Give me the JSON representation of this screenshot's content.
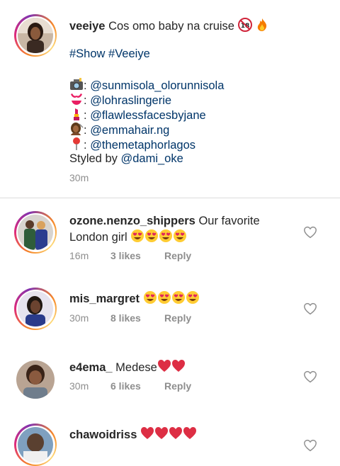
{
  "post": {
    "username": "veeiye",
    "caption_line1": "Cos omo baby na cruise",
    "hashtags": "#Show #Veeiye",
    "credits": [
      {
        "icon": "camera-icon",
        "handle": "@sunmisola_olorunnisola"
      },
      {
        "icon": "bikini-icon",
        "handle": "@lohraslingerie"
      },
      {
        "icon": "lipstick-icon",
        "handle": "@flawlessfacesbyjane"
      },
      {
        "icon": "hair-salon-icon",
        "handle": "@emmahair.ng"
      },
      {
        "icon": "pin-icon",
        "handle": "@themetaphorlagos"
      }
    ],
    "styled_prefix": "Styled by",
    "styled_handle": "@dami_oke",
    "time": "30m",
    "colon": ":"
  },
  "comments": [
    {
      "username": "ozone.nenzo_shippers",
      "text_line1": "Our favorite",
      "text_line2": "London girl",
      "emojis": [
        "heart-eyes",
        "heart-eyes",
        "heart-eyes",
        "heart-eyes"
      ],
      "time": "16m",
      "likes": "3 likes",
      "reply": "Reply"
    },
    {
      "username": "mis_margret",
      "text_line1": "",
      "emojis": [
        "heart-eyes",
        "heart-eyes",
        "heart-eyes",
        "heart-eyes"
      ],
      "time": "30m",
      "likes": "8 likes",
      "reply": "Reply"
    },
    {
      "username": "e4ema_",
      "text_line1": "Medese",
      "emojis": [
        "red-heart",
        "red-heart"
      ],
      "time": "30m",
      "likes": "6 likes",
      "reply": "Reply"
    },
    {
      "username": "chawoidriss",
      "text_line1": "",
      "emojis": [
        "red-heart",
        "red-heart",
        "red-heart",
        "red-heart"
      ]
    }
  ],
  "colors": {
    "link": "#003569",
    "meta": "#8e8e8e",
    "heart": "#e0245e"
  }
}
